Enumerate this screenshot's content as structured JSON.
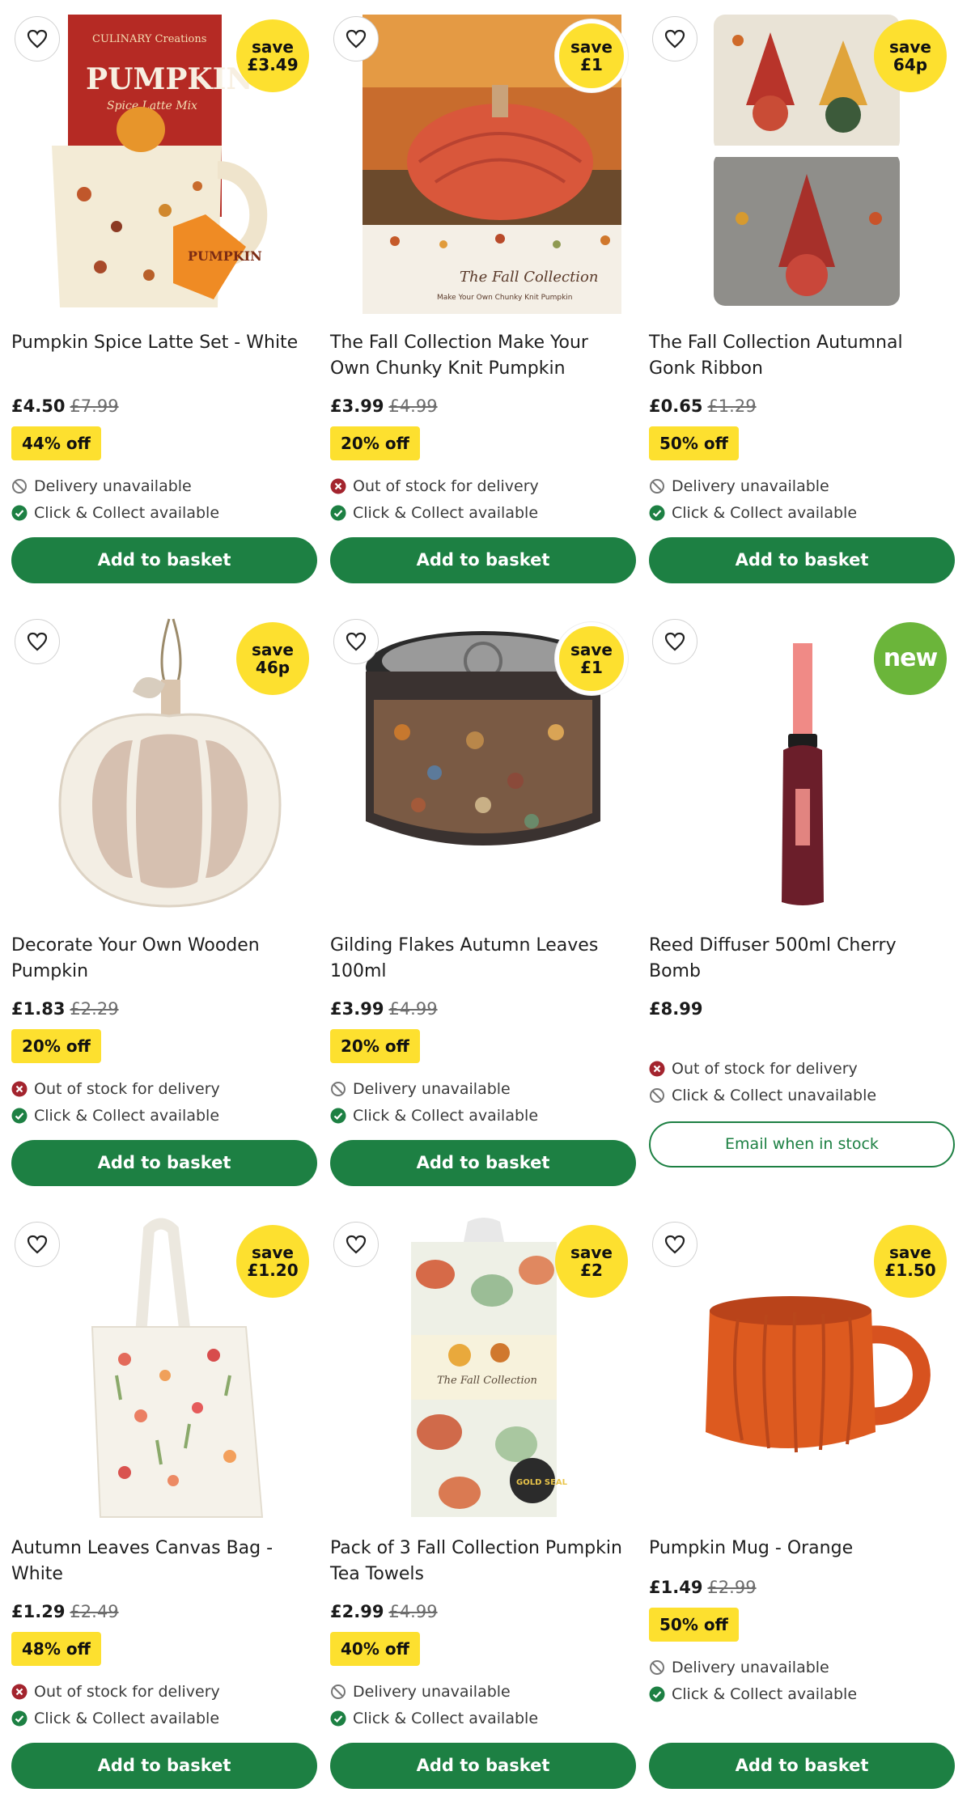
{
  "colors": {
    "brand_green": "#1d8043",
    "promo_yellow": "#fde02f",
    "new_green": "#6bb53a",
    "error_red": "#a3242e"
  },
  "products": [
    {
      "title": "Pumpkin Spice Latte Set - White",
      "price": "£4.50",
      "was": "£7.99",
      "off": "44% off",
      "badge_line1": "save",
      "badge_line2": "£3.49",
      "delivery": "Delivery unavailable",
      "delivery_icon": "blocked-icon",
      "collect": "Click & Collect available",
      "collect_icon": "check-icon",
      "button": "Add to basket"
    },
    {
      "title": "The Fall Collection Make Your Own Chunky Knit Pumpkin",
      "price": "£3.99",
      "was": "£4.99",
      "off": "20% off",
      "badge_line1": "save",
      "badge_line2": "£1",
      "delivery": "Out of stock for delivery",
      "delivery_icon": "cross-icon",
      "collect": "Click & Collect available",
      "collect_icon": "check-icon",
      "button": "Add to basket"
    },
    {
      "title": "The Fall Collection Autumnal Gonk Ribbon",
      "price": "£0.65",
      "was": "£1.29",
      "off": "50% off",
      "badge_line1": "save",
      "badge_line2": "64p",
      "delivery": "Delivery unavailable",
      "delivery_icon": "blocked-icon",
      "collect": "Click & Collect available",
      "collect_icon": "check-icon",
      "button": "Add to basket"
    },
    {
      "title": "Decorate Your Own Wooden Pumpkin",
      "price": "£1.83",
      "was": "£2.29",
      "off": "20% off",
      "badge_line1": "save",
      "badge_line2": "46p",
      "delivery": "Out of stock for delivery",
      "delivery_icon": "cross-icon",
      "collect": "Click & Collect available",
      "collect_icon": "check-icon",
      "button": "Add to basket"
    },
    {
      "title": "Gilding Flakes Autumn Leaves 100ml",
      "price": "£3.99",
      "was": "£4.99",
      "off": "20% off",
      "badge_line1": "save",
      "badge_line2": "£1",
      "delivery": "Delivery unavailable",
      "delivery_icon": "blocked-icon",
      "collect": "Click & Collect available",
      "collect_icon": "check-icon",
      "button": "Add to basket"
    },
    {
      "title": "Reed Diffuser 500ml Cherry Bomb",
      "price": "£8.99",
      "was": "",
      "off": "",
      "badge_line1": "new",
      "badge_line2": "",
      "delivery": "Out of stock for delivery",
      "delivery_icon": "cross-icon",
      "collect": "Click & Collect unavailable",
      "collect_icon": "blocked-icon",
      "button": "Email when in stock"
    },
    {
      "title": "Autumn Leaves Canvas Bag - White",
      "price": "£1.29",
      "was": "£2.49",
      "off": "48% off",
      "badge_line1": "save",
      "badge_line2": "£1.20",
      "delivery": "Out of stock for delivery",
      "delivery_icon": "cross-icon",
      "collect": "Click & Collect available",
      "collect_icon": "check-icon",
      "button": "Add to basket"
    },
    {
      "title": "Pack of 3 Fall Collection Pumpkin Tea Towels",
      "price": "£2.99",
      "was": "£4.99",
      "off": "40% off",
      "badge_line1": "save",
      "badge_line2": "£2",
      "delivery": "Delivery unavailable",
      "delivery_icon": "blocked-icon",
      "collect": "Click & Collect available",
      "collect_icon": "check-icon",
      "button": "Add to basket"
    },
    {
      "title": "Pumpkin Mug - Orange",
      "price": "£1.49",
      "was": "£2.99",
      "off": "50% off",
      "badge_line1": "save",
      "badge_line2": "£1.50",
      "delivery": "Delivery unavailable",
      "delivery_icon": "blocked-icon",
      "collect": "Click & Collect available",
      "collect_icon": "check-icon",
      "button": "Add to basket"
    }
  ],
  "image_text": {
    "latte_brand": "CULINARY Creations",
    "latte_word": "PUMPKIN",
    "latte_sub": "Spice Latte Mix",
    "knit_caption": "The Fall Collection",
    "knit_sub": "Make Your Own Chunky Knit Pumpkin",
    "towel_label": "The Fall Collection",
    "towel_seal": "GOLD SEAL"
  }
}
